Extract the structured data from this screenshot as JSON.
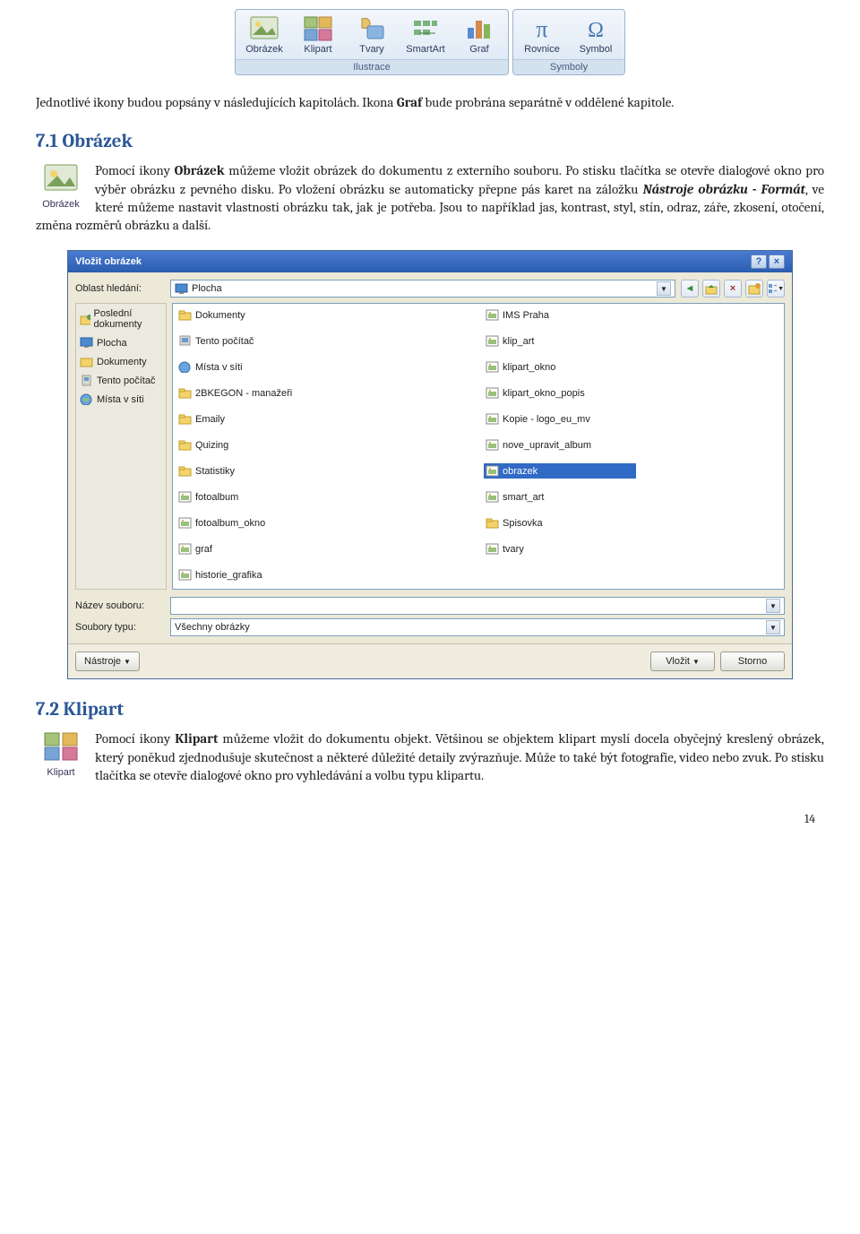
{
  "ribbon": {
    "group1_title": "Ilustrace",
    "group2_title": "Symboly",
    "items": [
      "Obrázek",
      "Klipart",
      "Tvary",
      "SmartArt",
      "Graf",
      "Rovnice",
      "Symbol"
    ]
  },
  "intro": {
    "p1_a": "Jednotlivé ikony budou popsány v následujících kapitolách. Ikona ",
    "p1_bold": "Graf",
    "p1_b": " bude probrána separátně v oddělené kapitole."
  },
  "s71": {
    "heading": "7.1  Obrázek",
    "icon_label": "Obrázek",
    "p_a": "Pomocí ikony ",
    "p_bold1": "Obrázek",
    "p_b": " můžeme vložit obrázek do dokumentu z externího souboru. Po stisku tlačítka se otevře dialogové okno pro výběr obrázku z pevného disku. Po vložení obrázku se automaticky přepne pás karet na záložku ",
    "p_italic": "Nástroje obrázku - Formát",
    "p_c": ", ve které můžeme nastavit vlastnosti obrázku tak, jak je potřeba. Jsou to například jas, kontrast, styl, stín, odraz, záře, zkosení, otočení, změna rozměrů obrázku a další."
  },
  "dialog": {
    "title": "Vložit obrázek",
    "search_label": "Oblast hledání:",
    "search_value": "Plocha",
    "places": [
      "Poslední dokumenty",
      "Plocha",
      "Dokumenty",
      "Tento počítač",
      "Místa v síti"
    ],
    "col1": [
      "Dokumenty",
      "Tento počítač",
      "Místa v síti",
      "2BKEGON - manažeři",
      "Emaily",
      "Quizing",
      "Statistiky",
      "fotoalbum",
      "fotoalbum_okno",
      "graf",
      "historie_grafika",
      "IMS Praha",
      "klip_art",
      "klipart_okno",
      "klipart_okno_popis",
      "Kopie - logo_eu_mv",
      "nove_upravit_album",
      "obrazek"
    ],
    "col1_selected": 17,
    "col1_type": [
      "folder",
      "computer",
      "network",
      "folder",
      "folder",
      "folder",
      "folder",
      "img",
      "img",
      "img",
      "img",
      "img",
      "img",
      "img",
      "img",
      "img",
      "img",
      "img"
    ],
    "col2": [
      "smart_art",
      "Spisovka",
      "tvary"
    ],
    "col2_type": [
      "img",
      "folder",
      "img"
    ],
    "filename_label": "Název souboru:",
    "filename_value": "",
    "filetype_label": "Soubory typu:",
    "filetype_value": "Všechny obrázky",
    "btn_tools": "Nástroje",
    "btn_insert": "Vložit",
    "btn_cancel": "Storno"
  },
  "s72": {
    "heading": "7.2  Klipart",
    "icon_label": "Klipart",
    "p_a": "Pomocí ikony ",
    "p_bold1": "Klipart",
    "p_b": " můžeme vložit do dokumentu objekt. Většinou se objektem klipart myslí docela obyčejný kreslený obrázek, který poněkud zjednodušuje skutečnost a některé důležité detaily zvýrazňuje. Může to také být fotografie, video nebo zvuk. Po stisku tlačítka se otevře dialogové okno pro vyhledávání a volbu typu klipartu."
  },
  "page_number": "14"
}
